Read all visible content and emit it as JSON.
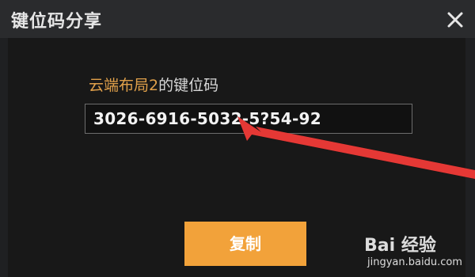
{
  "dialog": {
    "title": "键位码分享",
    "layout_name_prefix": "云端布局",
    "layout_number": "2",
    "layout_name_suffix": "的键位码",
    "code": "3026-6916-5032-5?54-92",
    "copy_label": "复制"
  },
  "watermark": {
    "logo_text": "Bai 经验",
    "url": "jingyan.baidu.com"
  },
  "colors": {
    "accent": "#e0a04a",
    "button": "#f2a23a",
    "annotation_arrow": "#e53935"
  },
  "icons": {
    "close": "close-icon",
    "arrow": "red-arrow-annotation"
  }
}
